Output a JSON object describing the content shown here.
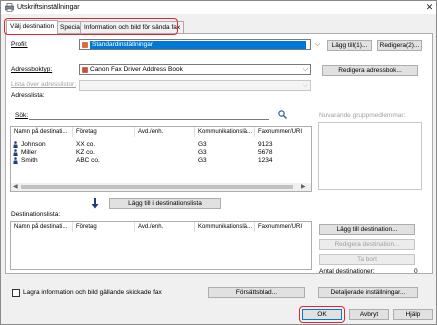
{
  "window": {
    "title": "Utskriftsinställningar",
    "close_glyph": "✕"
  },
  "tabs": [
    {
      "label": "Välj destination",
      "active": true
    },
    {
      "label": "Special",
      "active": false
    },
    {
      "label": "Information och bild för sända fax",
      "active": false
    }
  ],
  "profile": {
    "label": "Profil:",
    "value": "Standardinställningar",
    "add_label": "Lägg till(1)...",
    "edit_label": "Redigera(2)..."
  },
  "addressbook": {
    "label": "Adressboktyp:",
    "value": "Canon Fax Driver Address Book",
    "edit_label": "Redigera adressbok...",
    "list_label": "Lista över adresslistor:",
    "list_value": "",
    "addresslist_label": "Adresslista:"
  },
  "search": {
    "label": "Sök:",
    "value": "",
    "icon": "search-icon"
  },
  "group_members_label": "Nuvarande gruppmedlemmar:",
  "address_table": {
    "columns": [
      "Namn på destinati...",
      "Företag",
      "Avd./enh.",
      "Kommunikationslä...",
      "Faxnummer/URI"
    ],
    "rows": [
      {
        "name": "Johnson",
        "company": "XX co.",
        "dept": "",
        "mode": "G3",
        "fax": "9123"
      },
      {
        "name": "Miller",
        "company": "KZ co.",
        "dept": "",
        "mode": "G3",
        "fax": "5678"
      },
      {
        "name": "Smith",
        "company": "ABC co.",
        "dept": "",
        "mode": "G3",
        "fax": "1234"
      }
    ]
  },
  "add_to_list_label": "Lägg till i destinationslista",
  "destination_list": {
    "label": "Destinationslista:",
    "columns": [
      "Namn på destinati...",
      "Företag",
      "Avd./enh.",
      "Kommunikationslä...",
      "Faxnummer/URI"
    ],
    "rows": []
  },
  "dest_buttons": {
    "add": "Lägg till destination...",
    "edit": "Redigera destination...",
    "remove": "Ta bort",
    "count_label": "Antal destinationer:",
    "count_value": "0"
  },
  "bottom": {
    "store_checkbox_label": "Lagra information och bild gällande skickade fax",
    "cover_sheet_label": "Försättsblad...",
    "detailed_settings_label": "Detaljerade inställningar..."
  },
  "footer": {
    "ok_label": "OK",
    "cancel_label": "Avbryt",
    "help_label": "Hjälp"
  },
  "colors": {
    "accent": "#0078d7",
    "highlight": "#e3262e"
  }
}
